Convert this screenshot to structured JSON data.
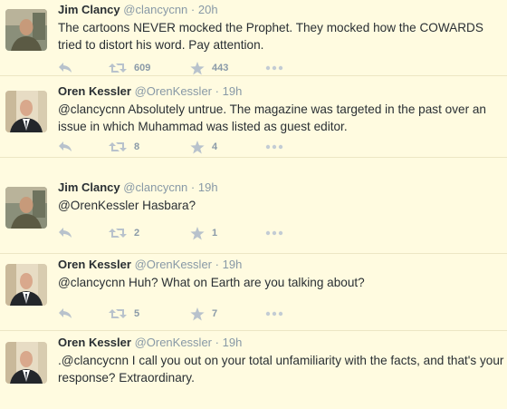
{
  "tweets": [
    {
      "name": "Jim Clancy",
      "handle": "@clancycnn",
      "separator": "·",
      "time": "20h",
      "text": "The cartoons NEVER mocked the Prophet.  They mocked how the COWARDS tried to distort his word.  Pay attention.",
      "retweets": "609",
      "favorites": "443",
      "avatar": "jim"
    },
    {
      "name": "Oren Kessler",
      "handle": "@OrenKessler",
      "separator": "·",
      "time": "19h",
      "text": "@clancycnn Absolutely untrue. The magazine was targeted in the past over an issue in which Muhammad was listed as guest editor.",
      "retweets": "8",
      "favorites": "4",
      "avatar": "oren"
    },
    {
      "name": "Jim Clancy",
      "handle": "@clancycnn",
      "separator": "·",
      "time": "19h",
      "text": "@OrenKessler Hasbara?",
      "retweets": "2",
      "favorites": "1",
      "avatar": "jim"
    },
    {
      "name": "Oren Kessler",
      "handle": "@OrenKessler",
      "separator": "·",
      "time": "19h",
      "text": "@clancycnn Huh? What on Earth are you talking about?",
      "retweets": "5",
      "favorites": "7",
      "avatar": "oren"
    },
    {
      "name": "Oren Kessler",
      "handle": "@OrenKessler",
      "separator": "·",
      "time": "19h",
      "text": ".@clancycnn I call you out on your total unfamiliarity with the facts, and that's your response? Extraordinary.",
      "retweets": "",
      "favorites": "",
      "avatar": "oren"
    }
  ],
  "icons": {
    "reply": "reply-icon",
    "retweet": "retweet-icon",
    "favorite": "star-icon",
    "more": "more-icon"
  },
  "colors": {
    "background": "#fffbe0",
    "icon_gray": "#b8c2cc",
    "handle_gray": "#8899a6"
  }
}
